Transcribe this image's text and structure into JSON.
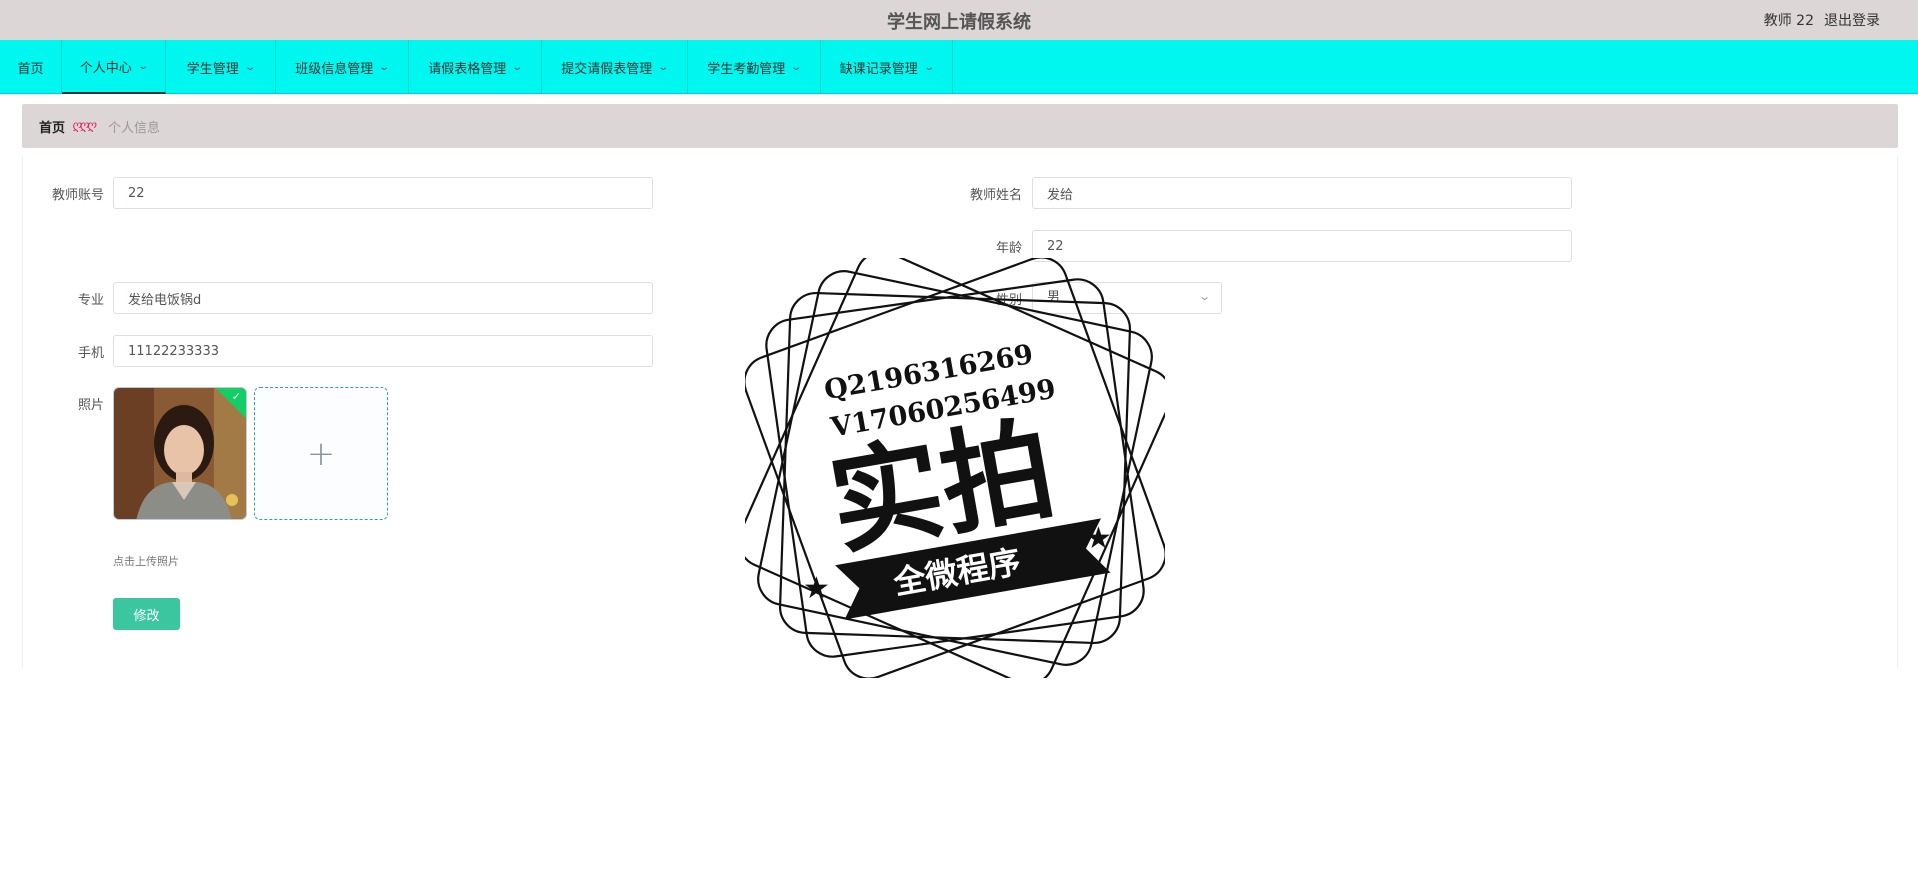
{
  "header": {
    "title": "学生网上请假系统",
    "user": "教师 22",
    "logout": "退出登录"
  },
  "nav": {
    "items": [
      {
        "label": "首页"
      },
      {
        "label": "个人中心"
      },
      {
        "label": "学生管理"
      },
      {
        "label": "班级信息管理"
      },
      {
        "label": "请假表格管理"
      },
      {
        "label": "提交请假表管理"
      },
      {
        "label": "学生考勤管理"
      },
      {
        "label": "缺课记录管理"
      }
    ],
    "active": "个人中心",
    "chevron_icon": "chevron-down-icon"
  },
  "breadcrumb": {
    "home": "首页",
    "current": "个人信息"
  },
  "form": {
    "account": {
      "label": "教师账号",
      "value": "22"
    },
    "name": {
      "label": "教师姓名",
      "value": "发给"
    },
    "age": {
      "label": "年龄",
      "value": "22"
    },
    "major": {
      "label": "专业",
      "value": "发给电饭锅d"
    },
    "gender": {
      "label": "性别",
      "value": "男"
    },
    "phone": {
      "label": "手机",
      "value": "11122233333"
    },
    "photo": {
      "label": "照片",
      "upload_tip": "点击上传照片"
    },
    "submit": "修改"
  },
  "watermark": {
    "line1": "Q2196316269",
    "line2": "V17060256499",
    "big": "实拍",
    "banner": "全微程序"
  },
  "colors": {
    "topbar": "#dcd6d6",
    "navbar": "#00f7ef",
    "button": "#3cc6a0",
    "success": "#13ce66"
  }
}
